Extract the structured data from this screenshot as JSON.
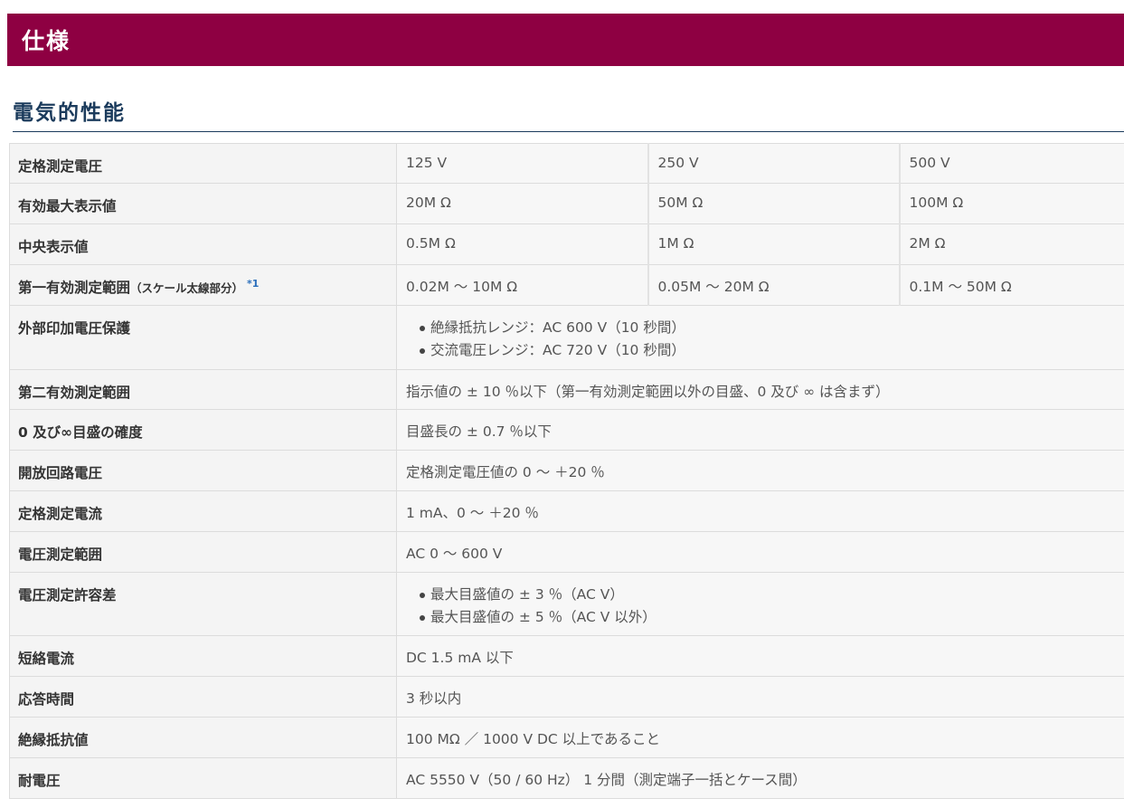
{
  "page_title": "仕様",
  "section_title": "電気的性能",
  "rows": {
    "rated_voltage": {
      "label": "定格測定電圧",
      "v1": "125 V",
      "v2": "250 V",
      "v3": "500 V"
    },
    "max_display": {
      "label": "有効最大表示値",
      "v1": "20M Ω",
      "v2": "50M Ω",
      "v3": "100M Ω"
    },
    "center_display": {
      "label": "中央表示値",
      "v1": "0.5M Ω",
      "v2": "1M Ω",
      "v3": "2M Ω"
    },
    "first_range": {
      "label": "第一有効測定範囲",
      "label_note": "（スケール太線部分）",
      "footnote": "*1",
      "v1": "0.02M 〜 10M Ω",
      "v2": "0.05M 〜 20M Ω",
      "v3": "0.1M 〜 50M Ω"
    },
    "ext_protection": {
      "label": "外部印加電圧保護",
      "items": [
        "絶縁抵抗レンジ：AC 600 V（10 秒間）",
        "交流電圧レンジ：AC 720 V（10 秒間）"
      ]
    },
    "second_range": {
      "label": "第二有効測定範囲",
      "value": "指示値の ± 10 ％以下（第一有効測定範囲以外の目盛、0 及び ∞ は含まず）"
    },
    "zero_inf_accuracy": {
      "label": "0 及び∞目盛の確度",
      "value": "目盛長の ± 0.7 ％以下"
    },
    "open_circuit": {
      "label": "開放回路電圧",
      "value": "定格測定電圧値の 0 〜 ＋20 ％"
    },
    "rated_current": {
      "label": "定格測定電流",
      "value": "1 mA、0 〜 ＋20 ％"
    },
    "voltage_range": {
      "label": "電圧測定範囲",
      "value": "AC 0 〜 600 V"
    },
    "voltage_tolerance": {
      "label": "電圧測定許容差",
      "items": [
        "最大目盛値の ± 3 ％（AC V）",
        "最大目盛値の ± 5 ％（AC V 以外）"
      ]
    },
    "short_current": {
      "label": "短絡電流",
      "value": "DC 1.5 mA 以下"
    },
    "response_time": {
      "label": "応答時間",
      "value": "3 秒以内"
    },
    "insulation_resistance": {
      "label": "絶縁抵抗値",
      "value": "100 MΩ ／ 1000 V DC 以上であること"
    },
    "withstand_voltage": {
      "label": "耐電圧",
      "value": "AC 5550 V（50 / 60 Hz） 1 分間（測定端子一括とケース間）"
    }
  }
}
